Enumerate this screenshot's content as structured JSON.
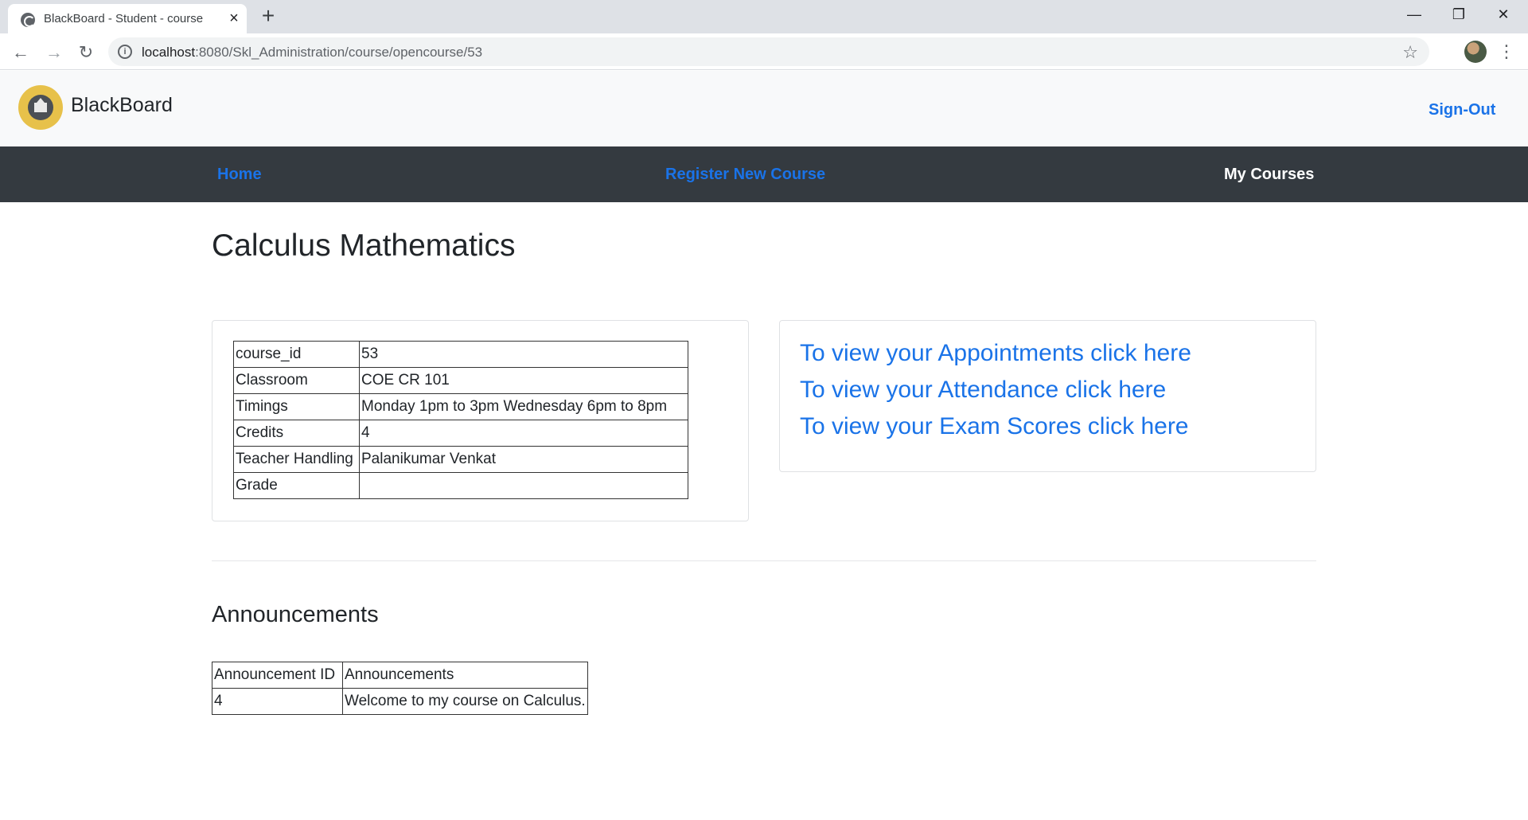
{
  "browser": {
    "tab_title": "BlackBoard - Student - course",
    "url_host": "localhost",
    "url_rest": ":8080/Skl_Administration/course/opencourse/53"
  },
  "header": {
    "brand": "BlackBoard",
    "signout": "Sign-Out"
  },
  "nav": {
    "home": "Home",
    "register": "Register New Course",
    "my_courses": "My Courses"
  },
  "course": {
    "title": "Calculus Mathematics",
    "details": [
      {
        "key": "course_id",
        "value": "53"
      },
      {
        "key": "Classroom",
        "value": "COE CR 101"
      },
      {
        "key": "Timings",
        "value": "Monday 1pm to 3pm Wednesday 6pm to 8pm"
      },
      {
        "key": "Credits",
        "value": "4"
      },
      {
        "key": "Teacher Handling",
        "value": "Palanikumar Venkat"
      },
      {
        "key": "Grade",
        "value": ""
      }
    ]
  },
  "links": {
    "appointments": "To view your Appointments click here",
    "attendance": "To view your Attendance click here",
    "exam_scores": "To view your Exam Scores click here"
  },
  "announcements": {
    "title": "Announcements",
    "headers": [
      "Announcement ID",
      "Announcements"
    ],
    "rows": [
      {
        "id": "4",
        "text": "Welcome to my course on Calculus."
      }
    ]
  },
  "colors": {
    "link": "#1a73e8",
    "navbar": "#343a40",
    "header_bg": "#f8f9fa",
    "logo": "#e7c14a"
  }
}
